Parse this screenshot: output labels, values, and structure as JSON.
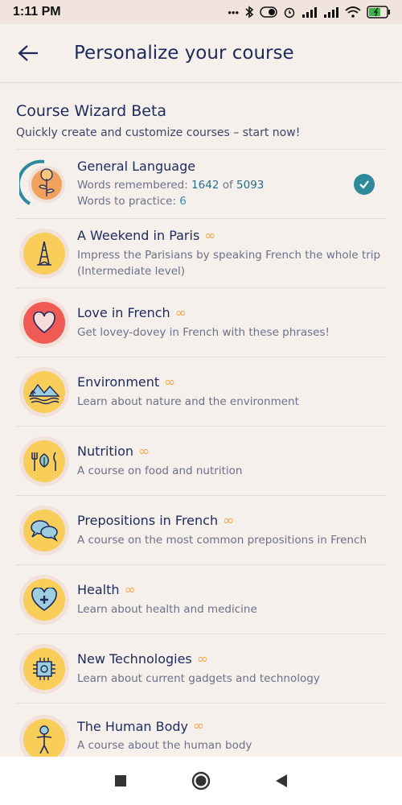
{
  "status": {
    "time": "1:11 PM"
  },
  "appbar": {
    "title": "Personalize your course",
    "back_icon": "arrow-left-icon"
  },
  "wizard": {
    "title": "Course Wizard Beta",
    "subtitle": "Quickly create and customize courses – start now!"
  },
  "courses": [
    {
      "title": "General Language",
      "line1_prefix": "Words remembered: ",
      "remembered": "1642",
      "of": " of ",
      "total": "5093",
      "line2_prefix": "Words to practice: ",
      "practice": "6",
      "selected": true,
      "icon": "sun-plant-icon"
    },
    {
      "title": "A Weekend in Paris",
      "desc": "Impress the Parisians by speaking French the whole trip (Intermediate level)",
      "icon": "eiffel-tower-icon"
    },
    {
      "title": "Love in French",
      "desc": "Get lovey-dovey in French with these phrases!",
      "icon": "heart-icon"
    },
    {
      "title": "Environment",
      "desc": "Learn about nature and the environment",
      "icon": "mountains-icon"
    },
    {
      "title": "Nutrition",
      "desc": "A course on food and nutrition",
      "icon": "food-icon"
    },
    {
      "title": "Prepositions in French",
      "desc": "A course on the most common prepositions in French",
      "icon": "speech-bubbles-icon"
    },
    {
      "title": "Health",
      "desc": "Learn about health and medicine",
      "icon": "health-heart-icon"
    },
    {
      "title": "New Technologies",
      "desc": "Learn about current gadgets and technology",
      "icon": "chip-icon"
    },
    {
      "title": "The Human Body",
      "desc": "A course about the human body",
      "icon": "body-icon"
    }
  ],
  "infinity_symbol": "∞",
  "colors": {
    "accent": "#2d8a9b",
    "infinity": "#f0a850",
    "text": "#1e2a5a"
  }
}
